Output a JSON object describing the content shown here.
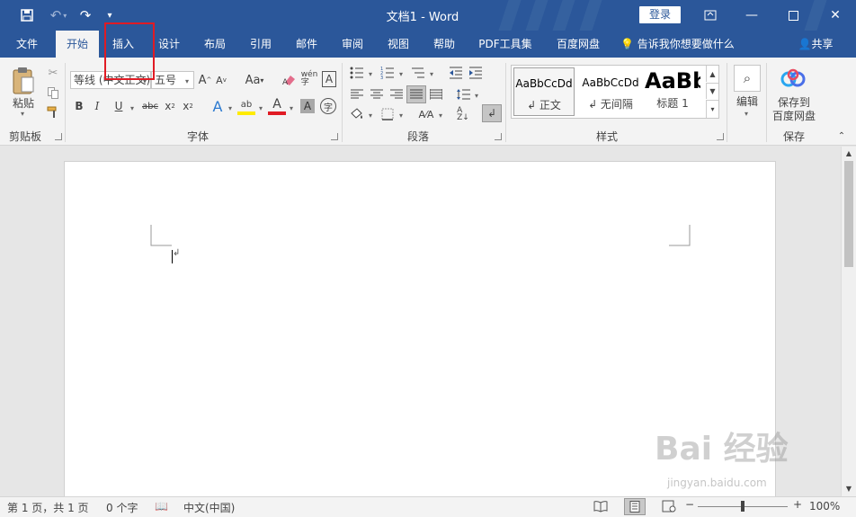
{
  "window": {
    "doc_title": "文档1  -  Word",
    "login": "登录"
  },
  "tabs": [
    {
      "label": "文件"
    },
    {
      "label": "开始"
    },
    {
      "label": "插入"
    },
    {
      "label": "设计"
    },
    {
      "label": "布局"
    },
    {
      "label": "引用"
    },
    {
      "label": "邮件"
    },
    {
      "label": "审阅"
    },
    {
      "label": "视图"
    },
    {
      "label": "帮助"
    },
    {
      "label": "PDF工具集"
    },
    {
      "label": "百度网盘"
    }
  ],
  "tell_me": "告诉我你想要做什么",
  "share": "共享",
  "clipboard": {
    "paste": "粘贴",
    "group": "剪贴板"
  },
  "font": {
    "name": "等线 (中文正文)",
    "size": "五号",
    "group": "字体"
  },
  "paragraph": {
    "group": "段落"
  },
  "styles": {
    "group": "样式",
    "items": [
      {
        "preview": "AaBbCcDd",
        "name": "↲ 正文"
      },
      {
        "preview": "AaBbCcDd",
        "name": "↲ 无间隔"
      },
      {
        "preview": "AaBb",
        "name": "标题 1"
      }
    ]
  },
  "editing": {
    "label": "编辑"
  },
  "save_group": {
    "label_line1": "保存到",
    "label_line2": "百度网盘",
    "group": "保存"
  },
  "status": {
    "page": "第 1 页，共 1 页",
    "words": "0 个字",
    "lang": "中文(中国)",
    "zoom": "100%"
  },
  "watermark": {
    "text": "Bai 经验",
    "url": "jingyan.baidu.com"
  }
}
